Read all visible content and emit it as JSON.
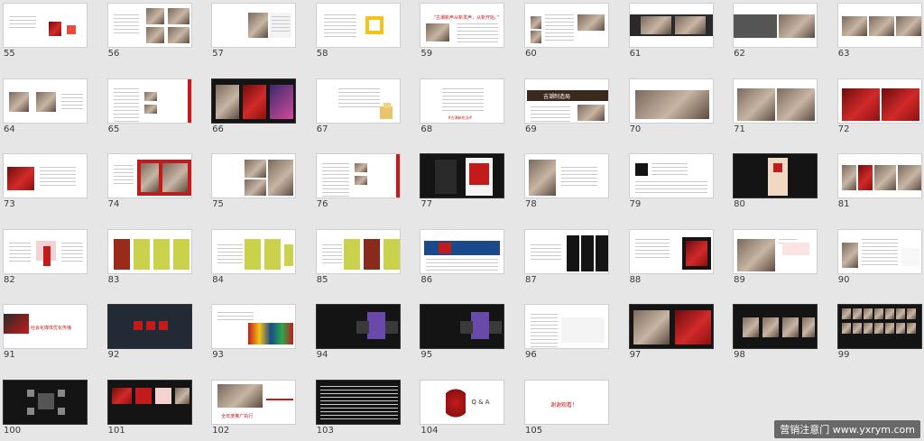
{
  "slides": [
    {
      "num": "55"
    },
    {
      "num": "56"
    },
    {
      "num": "57"
    },
    {
      "num": "58"
    },
    {
      "num": "59"
    },
    {
      "num": "60"
    },
    {
      "num": "61"
    },
    {
      "num": "62"
    },
    {
      "num": "63"
    },
    {
      "num": "64"
    },
    {
      "num": "65"
    },
    {
      "num": "66"
    },
    {
      "num": "67"
    },
    {
      "num": "68"
    },
    {
      "num": "69"
    },
    {
      "num": "70"
    },
    {
      "num": "71"
    },
    {
      "num": "72"
    },
    {
      "num": "73"
    },
    {
      "num": "74"
    },
    {
      "num": "75"
    },
    {
      "num": "76"
    },
    {
      "num": "77"
    },
    {
      "num": "78"
    },
    {
      "num": "79"
    },
    {
      "num": "80"
    },
    {
      "num": "81"
    },
    {
      "num": "82"
    },
    {
      "num": "83"
    },
    {
      "num": "84"
    },
    {
      "num": "85"
    },
    {
      "num": "86"
    },
    {
      "num": "87"
    },
    {
      "num": "88"
    },
    {
      "num": "89"
    },
    {
      "num": "90"
    },
    {
      "num": "91"
    },
    {
      "num": "92"
    },
    {
      "num": "93"
    },
    {
      "num": "94"
    },
    {
      "num": "95"
    },
    {
      "num": "96"
    },
    {
      "num": "97"
    },
    {
      "num": "98"
    },
    {
      "num": "99"
    },
    {
      "num": "100"
    },
    {
      "num": "101"
    },
    {
      "num": "102"
    },
    {
      "num": "103"
    },
    {
      "num": "104"
    },
    {
      "num": "105"
    }
  ],
  "slide_text": {
    "s59_title": "“古潮新声从新发声，从新开始。”",
    "s68_banner": "#古潮新吃法#",
    "s69_title": "吉潮制造局",
    "s91_section": "社会化媒体优化传播",
    "s102_section": "全年度推广执行",
    "s104_label": "Q & A",
    "s105_label": "谢谢观看！"
  },
  "watermark": "营销注意门 www.yxrym.com",
  "colors": {
    "background": "#e6e6e6",
    "accent_red": "#c31b1b",
    "thumb_bg": "#ffffff",
    "dark_thumb_bg": "#141414"
  }
}
